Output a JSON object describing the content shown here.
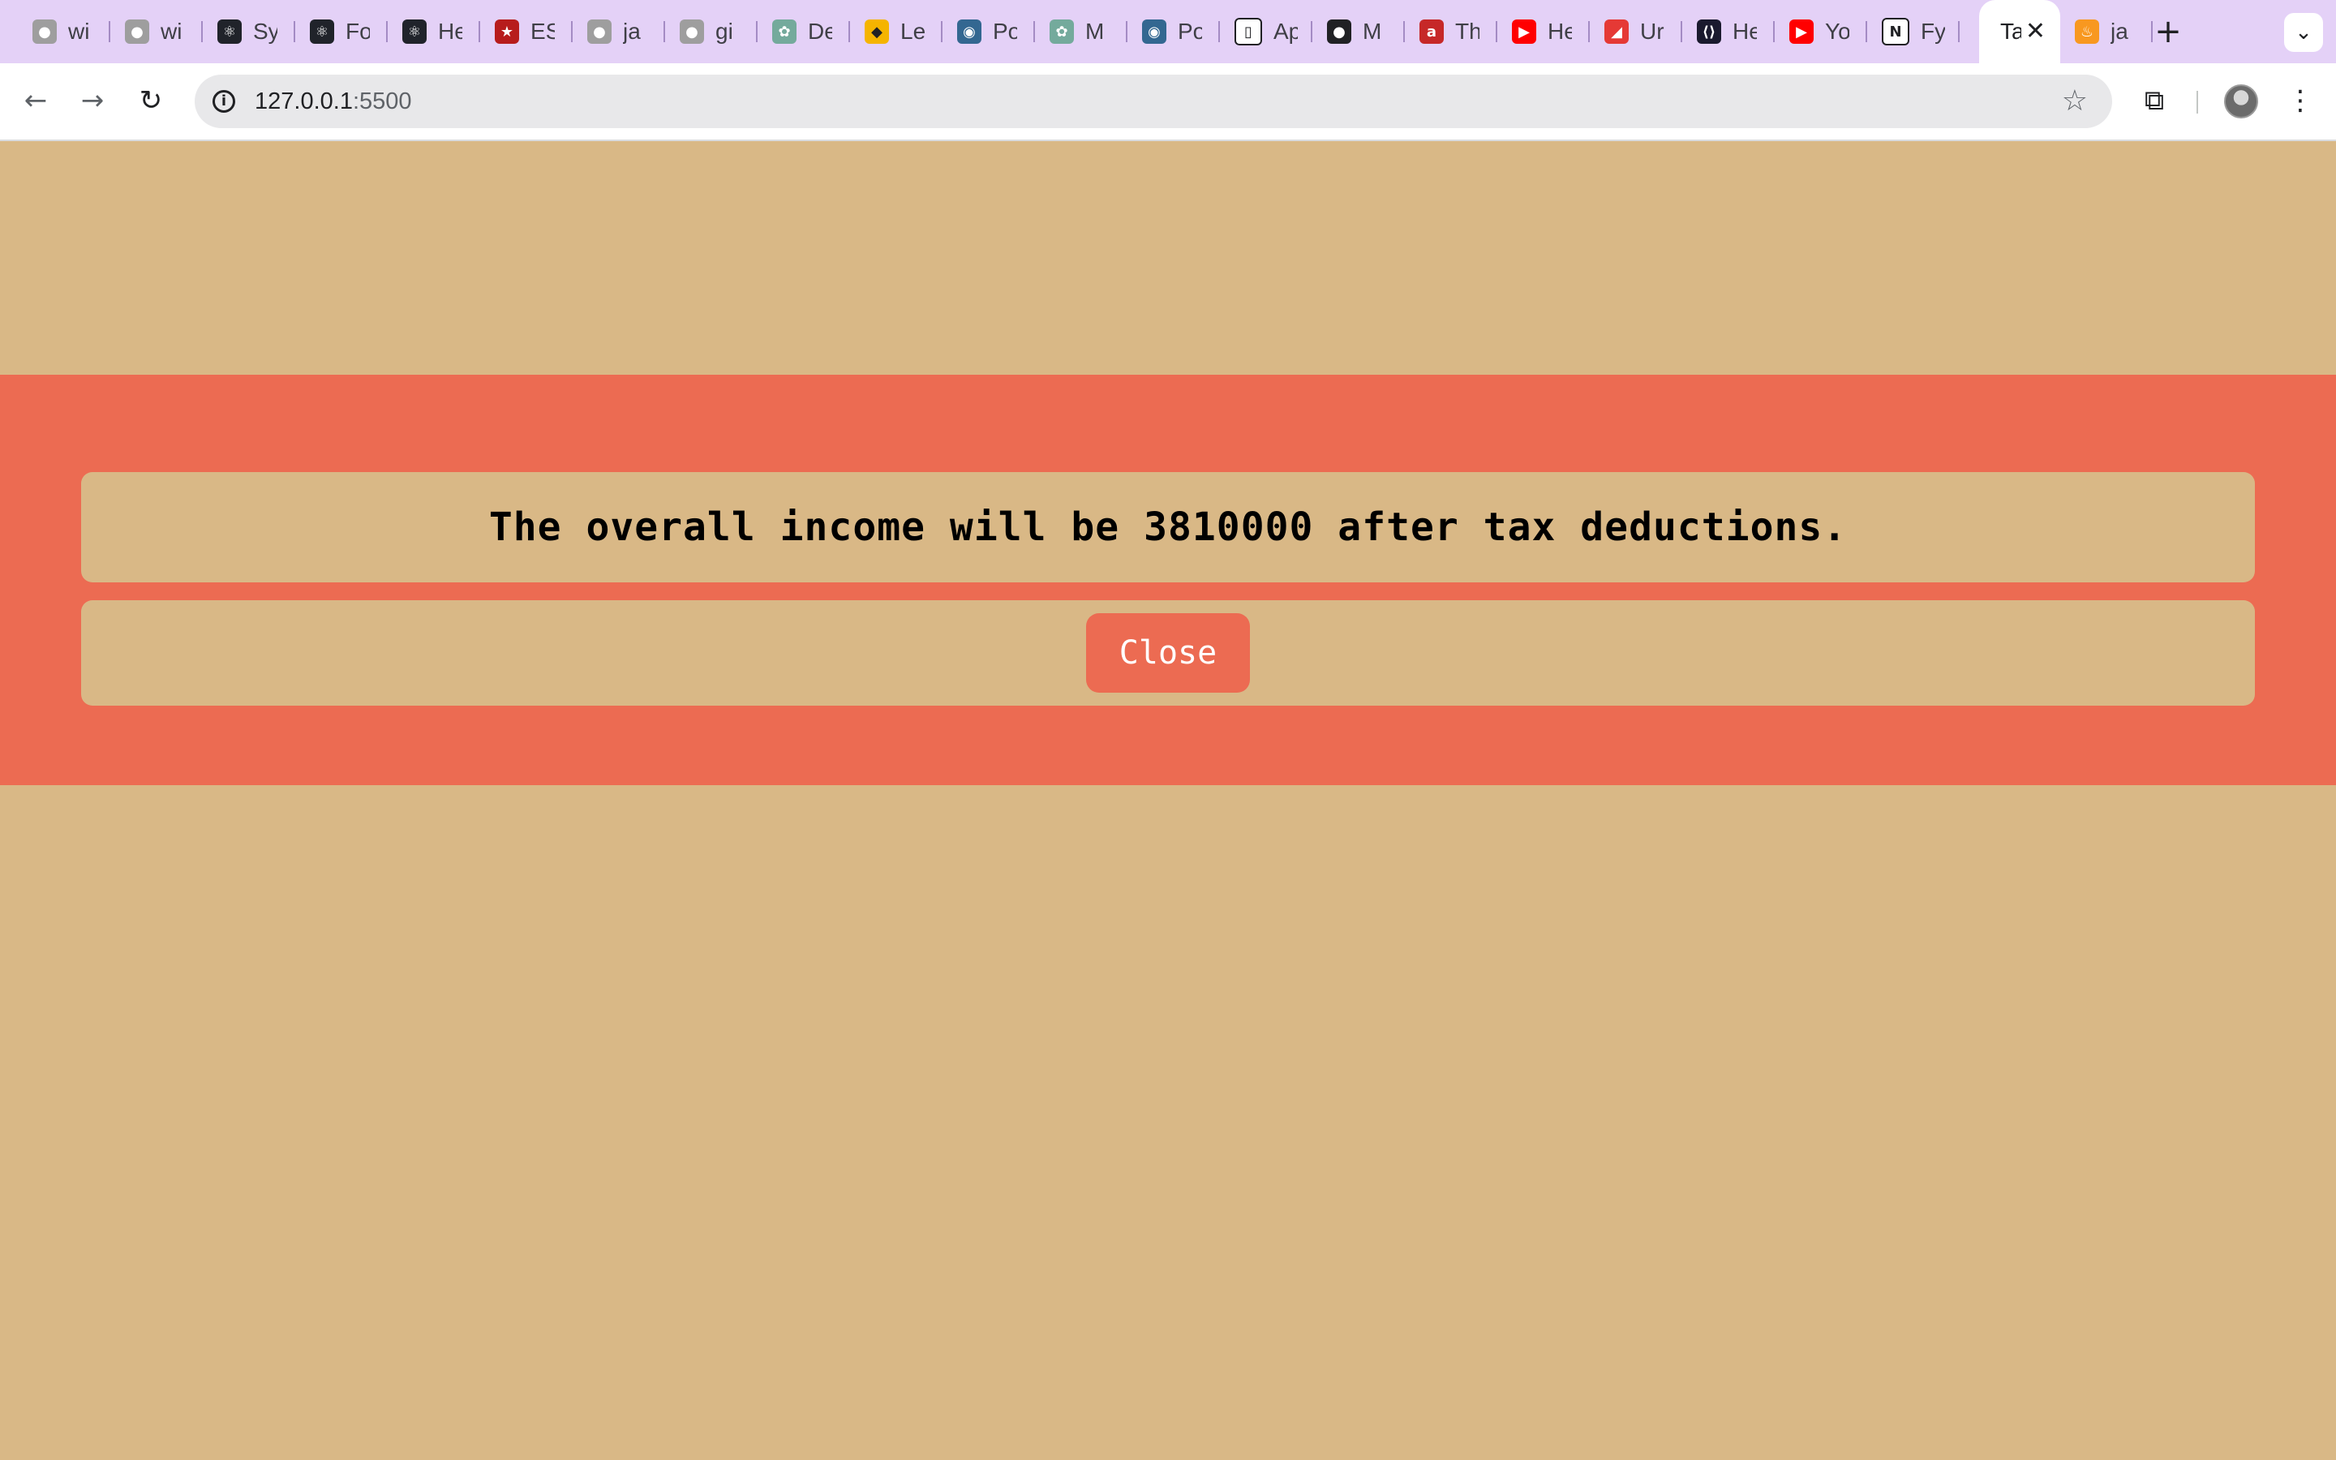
{
  "browser": {
    "tabs": [
      {
        "title": "wi",
        "icon": "grey-circle-icon",
        "color": "#9e9e9e"
      },
      {
        "title": "wi",
        "icon": "grey-circle-icon",
        "color": "#9e9e9e"
      },
      {
        "title": "Sy",
        "icon": "react-icon",
        "color": "#20232a"
      },
      {
        "title": "Fo",
        "icon": "react-icon",
        "color": "#20232a"
      },
      {
        "title": "He",
        "icon": "react-icon",
        "color": "#20232a"
      },
      {
        "title": "ES",
        "icon": "star-icon",
        "color": "#b71c1c"
      },
      {
        "title": "ja",
        "icon": "github-icon",
        "color": "#9e9e9e"
      },
      {
        "title": "gi",
        "icon": "github-icon",
        "color": "#9e9e9e"
      },
      {
        "title": "De",
        "icon": "chatgpt-icon",
        "color": "#74aa9c"
      },
      {
        "title": "Le",
        "icon": "leetcode-icon",
        "color": "#f5b400"
      },
      {
        "title": "Po",
        "icon": "postgres-icon",
        "color": "#336791"
      },
      {
        "title": "M",
        "icon": "chatgpt-icon",
        "color": "#74aa9c"
      },
      {
        "title": "Po",
        "icon": "postgres-icon",
        "color": "#336791"
      },
      {
        "title": "Ap",
        "icon": "document-icon",
        "color": "#ffffff"
      },
      {
        "title": "M",
        "icon": "github-icon",
        "color": "#202124"
      },
      {
        "title": "Th",
        "icon": "a-icon",
        "color": "#c62828"
      },
      {
        "title": "He",
        "icon": "youtube-icon",
        "color": "#ff0000"
      },
      {
        "title": "Ur",
        "icon": "udemy-icon",
        "color": "#e53935"
      },
      {
        "title": "He",
        "icon": "code-icon",
        "color": "#1a1a2e"
      },
      {
        "title": "Yo",
        "icon": "youtube-icon",
        "color": "#ff0000"
      },
      {
        "title": "Fy",
        "icon": "notion-icon",
        "color": "#ffffff"
      }
    ],
    "active_tab": {
      "title": "Ta",
      "close": "✕"
    },
    "extra_tab": {
      "title": "ja",
      "icon": "java-icon",
      "color": "#f89820"
    },
    "new_tab": "+",
    "tab_search": "⌄",
    "nav": {
      "back": "←",
      "forward": "→",
      "reload": "↻"
    },
    "url": {
      "host": "127.0.0.1",
      "port": ":5500"
    },
    "bookmark": "☆",
    "extensions": "⧉",
    "menu": "⋮"
  },
  "page": {
    "message": "The overall income will be 3810000 after tax deductions.",
    "close_label": "Close"
  },
  "colors": {
    "page_background": "#d9b886",
    "modal_background": "#ec6b52",
    "button": "#ec6b52"
  }
}
